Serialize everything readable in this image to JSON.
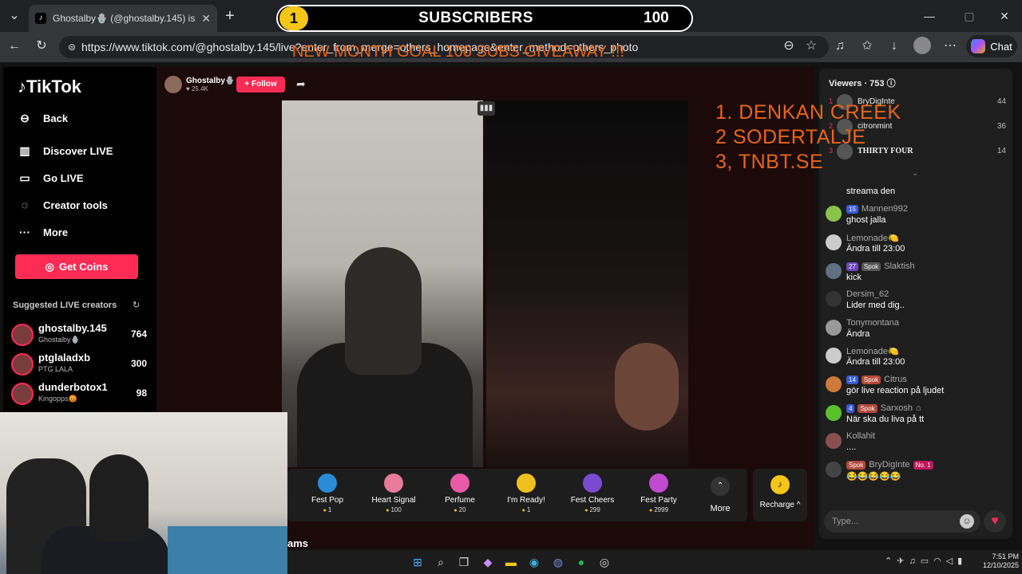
{
  "browser": {
    "tab_title": "Ghostalby🪬 (@ghostalby.145) is l",
    "url": "https://www.tiktok.com/@ghostalby.145/live?enter_from_merge=others_homepage&enter_method=others_photo",
    "chat_label": "Chat"
  },
  "overlay": {
    "coin_value": "1",
    "subscribers_label": "SUBSCRIBERS",
    "subscribers_count": "100",
    "goal_text": "NEW MONTH GOAL 100 SUBS GIVEAWAY !!!",
    "winners": [
      "1.  DENKAN CREEK",
      "2   SODERTALJE",
      "3,  TNBT.SE"
    ]
  },
  "sidebar": {
    "logo": "TikTok",
    "nav": [
      {
        "label": "Back",
        "icon": "back-arrow-icon"
      },
      {
        "label": "Discover LIVE",
        "icon": "live-tv-icon"
      },
      {
        "label": "Go LIVE",
        "icon": "camera-icon"
      },
      {
        "label": "Creator tools",
        "icon": "lightbulb-icon"
      },
      {
        "label": "More",
        "icon": "ellipsis-icon"
      }
    ],
    "get_coins": "Get Coins",
    "suggested_title": "Suggested LIVE creators",
    "suggested": [
      {
        "name": "ghostalby.145",
        "sub": "Ghostalby🪬",
        "count": "764"
      },
      {
        "name": "ptglaladxb",
        "sub": "PTG LALA",
        "count": "300"
      },
      {
        "name": "dunderbotox1",
        "sub": "Kingopps😡",
        "count": "98"
      }
    ]
  },
  "host": {
    "name": "Ghostalby🪬",
    "likes": "♥ 25.4K",
    "follow_label": "+ Follow"
  },
  "gifts": [
    {
      "name": "Fest Pop",
      "price": "1",
      "color": "#2a8cd6"
    },
    {
      "name": "Heart Signal",
      "price": "100",
      "color": "#e87a9a"
    },
    {
      "name": "Perfume",
      "price": "20",
      "color": "#e85aa8"
    },
    {
      "name": "I'm Ready!",
      "price": "1",
      "color": "#f0c020"
    },
    {
      "name": "Fest Cheers",
      "price": "299",
      "color": "#7a4ad0"
    },
    {
      "name": "Fest Party",
      "price": "2999",
      "color": "#c04ad0"
    }
  ],
  "more_label": "More",
  "recharge_label": "Recharge ^",
  "viewers": {
    "title": "Viewers · 753",
    "top": [
      {
        "rank": "1",
        "name": "BryDigInte",
        "count": "44"
      },
      {
        "rank": "2",
        "name": "citronmint",
        "count": "36"
      },
      {
        "rank": "3",
        "name": "THIRTY FOUR",
        "count": "14"
      }
    ]
  },
  "comments": [
    {
      "user": "",
      "text": "streama den",
      "badges": []
    },
    {
      "user": "Mannen992",
      "text": "ghost jalla",
      "badges": [
        {
          "t": "15",
          "c": "b-blue"
        }
      ]
    },
    {
      "user": "Lemonade🍋",
      "text": "Ändra till 23:00",
      "badges": []
    },
    {
      "user": "Slaktish",
      "text": "kick",
      "badges": [
        {
          "t": "27",
          "c": "b-purple"
        },
        {
          "t": "Spok",
          "c": "b-gray"
        }
      ]
    },
    {
      "user": "Dersim_62",
      "text": "Lider med dig..",
      "badges": []
    },
    {
      "user": "Tonymontana",
      "text": "Ändra",
      "badges": []
    },
    {
      "user": "Lemonade🍋",
      "text": "Ändra till 23:00",
      "badges": []
    },
    {
      "user": "Citrus",
      "text": "gör live reaction på ljudet",
      "badges": [
        {
          "t": "14",
          "c": "b-blue"
        },
        {
          "t": "Spok",
          "c": "b-spok"
        }
      ]
    },
    {
      "user": "Sarxosh",
      "text": "När ska du liva på tt",
      "badges": [
        {
          "t": "4",
          "c": "b-blue"
        },
        {
          "t": "Spok",
          "c": "b-spok"
        }
      ]
    },
    {
      "user": "Kollahit",
      "text": "....",
      "badges": []
    },
    {
      "user": "BryDigInte",
      "text": "😂😂😂😂😂",
      "badges": [
        {
          "t": "Spok",
          "c": "b-spok"
        }
      ],
      "tag": "No. 1"
    }
  ],
  "type_placeholder": "Type...",
  "bottom_text": "ams",
  "taskbar": {
    "time": "7:51 PM",
    "date": "12/10/2025"
  }
}
